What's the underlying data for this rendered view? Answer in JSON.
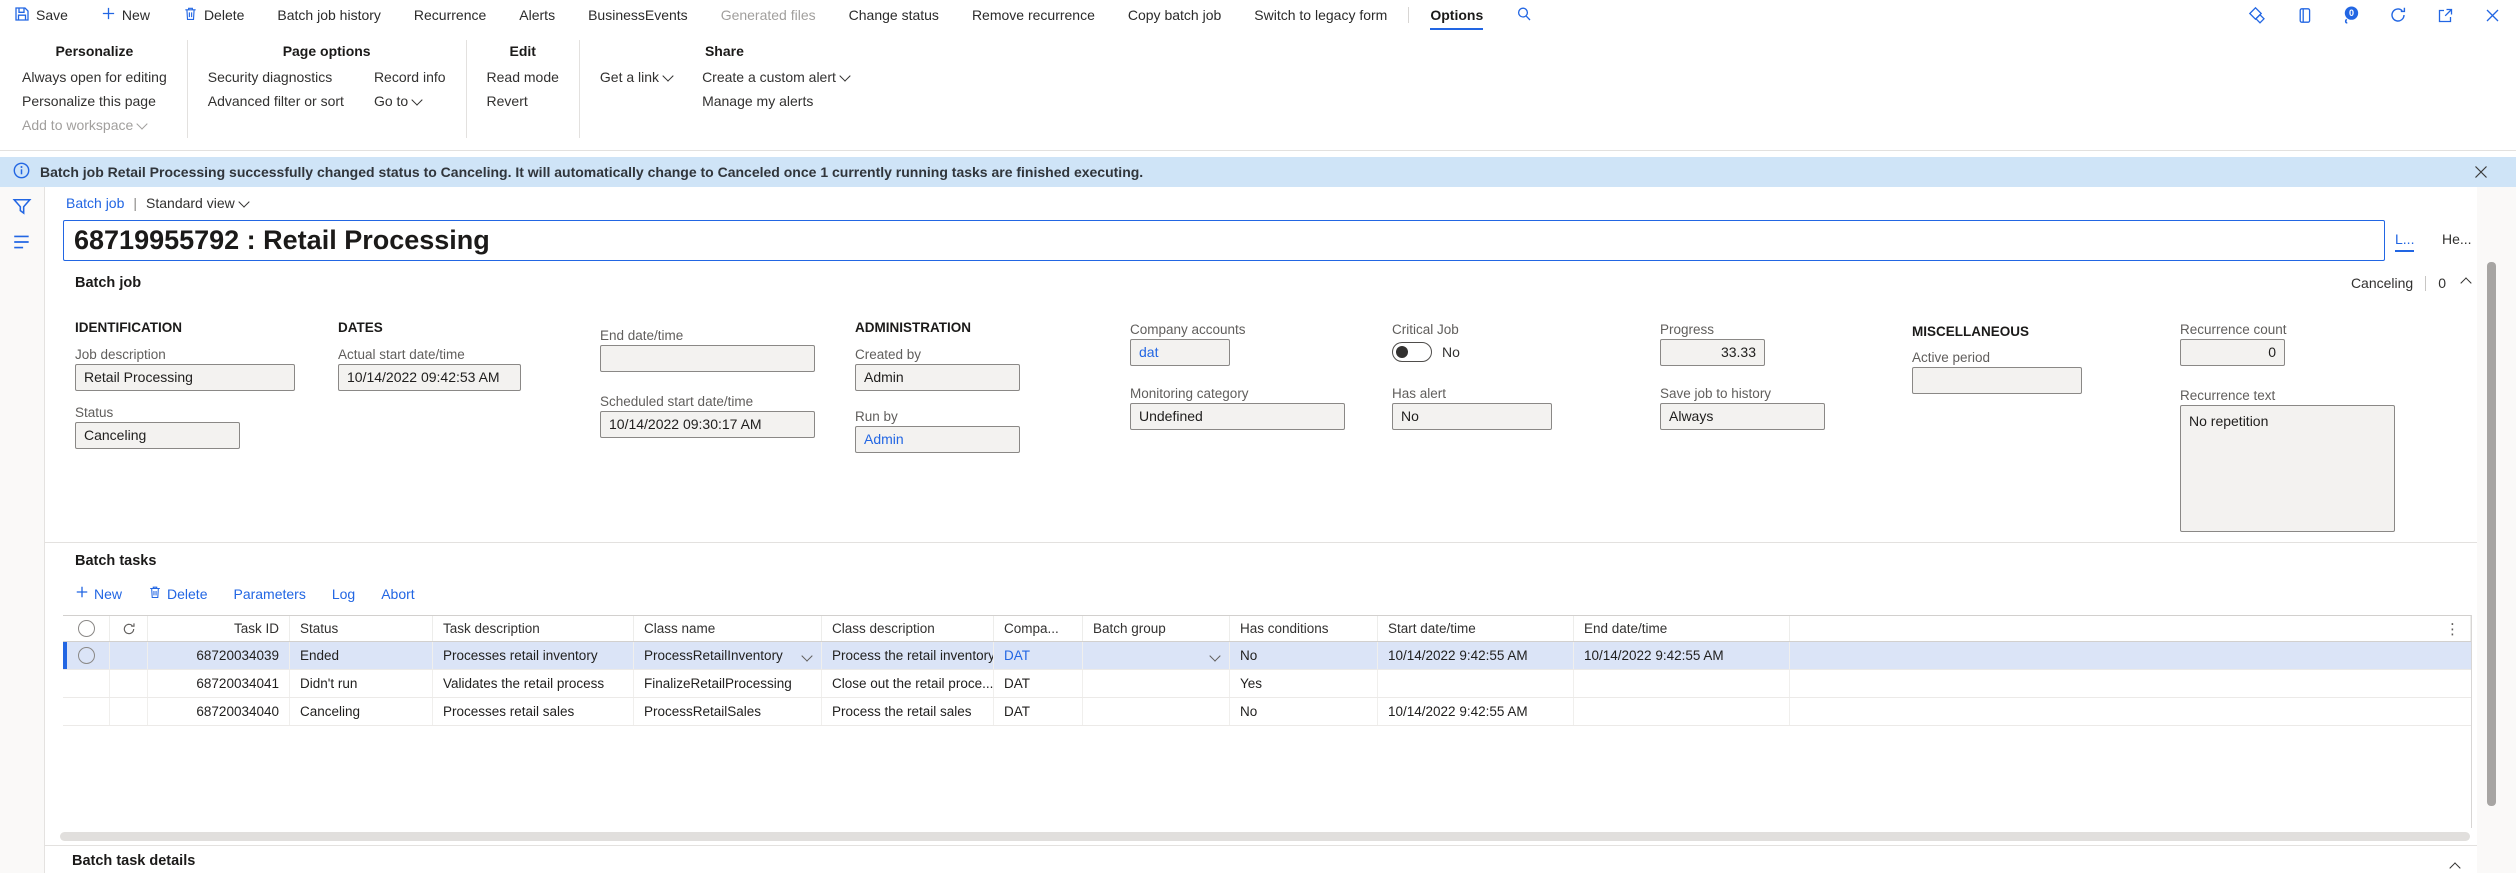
{
  "colors": {
    "accent": "#2266E3",
    "message_bar_bg": "#cfe4f7",
    "selected_row_bg": "#dbe4f7",
    "field_bg": "#f3f2f0",
    "disabled_text": "#a19f9d"
  },
  "icons": [
    "save-icon",
    "plus-icon",
    "trash-icon",
    "search-icon",
    "task-recorder-icon",
    "office-apps-icon",
    "notifications-icon",
    "refresh-icon",
    "popout-icon",
    "close-icon",
    "info-icon",
    "filter-funnel-icon",
    "nav-menu-icon",
    "chevron-down-icon",
    "chevron-up-icon",
    "more-icon",
    "radio-icon"
  ],
  "command_bar": {
    "items": [
      {
        "label": "Save"
      },
      {
        "label": "New"
      },
      {
        "label": "Delete"
      },
      {
        "label": "Batch job history"
      },
      {
        "label": "Recurrence"
      },
      {
        "label": "Alerts"
      },
      {
        "label": "BusinessEvents"
      },
      {
        "label": "Generated files"
      },
      {
        "label": "Change status"
      },
      {
        "label": "Remove recurrence"
      },
      {
        "label": "Copy batch job"
      },
      {
        "label": "Switch to legacy form"
      },
      {
        "label": "Options"
      }
    ],
    "notification_count": "0"
  },
  "ribbon": {
    "personalize": {
      "title": "Personalize",
      "items": [
        "Always open for editing",
        "Personalize this page",
        "Add to workspace"
      ]
    },
    "page_options": {
      "title": "Page options",
      "col1": [
        "Security diagnostics",
        "Advanced filter or sort"
      ],
      "col2": [
        "Record info",
        "Go to"
      ]
    },
    "edit": {
      "title": "Edit",
      "items": [
        "Read mode",
        "Revert"
      ]
    },
    "share": {
      "title": "Share",
      "col1": [
        "Get a link"
      ],
      "col2": [
        "Create a custom alert",
        "Manage my alerts"
      ]
    }
  },
  "message_bar": {
    "text": "Batch job Retail Processing successfully changed status to Canceling. It will automatically change to Canceled once 1 currently running tasks are finished executing."
  },
  "page": {
    "breadcrumb": "Batch job",
    "breadcrumb_separator": "|",
    "view": "Standard view",
    "title": "68719955792 : Retail Processing",
    "tabs": {
      "lines": "L...",
      "header": "He..."
    }
  },
  "sections": {
    "batch_job": {
      "title": "Batch job",
      "status": "Canceling",
      "count": "0"
    },
    "batch_tasks": {
      "title": "Batch tasks"
    },
    "batch_task_details": {
      "title": "Batch task details"
    }
  },
  "form": {
    "identification": {
      "header": "IDENTIFICATION",
      "job_description": {
        "label": "Job description",
        "value": "Retail Processing"
      },
      "status": {
        "label": "Status",
        "value": "Canceling"
      }
    },
    "dates": {
      "header": "DATES",
      "actual_start": {
        "label": "Actual start date/time",
        "value": "10/14/2022 09:42:53 AM"
      },
      "end": {
        "label": "End date/time",
        "value": ""
      },
      "scheduled_start": {
        "label": "Scheduled start date/time",
        "value": "10/14/2022 09:30:17 AM"
      }
    },
    "administration": {
      "header": "ADMINISTRATION",
      "created_by": {
        "label": "Created by",
        "value": "Admin"
      },
      "run_by": {
        "label": "Run by",
        "value": "Admin"
      },
      "company_accounts": {
        "label": "Company accounts",
        "value": "dat"
      },
      "monitoring_category": {
        "label": "Monitoring category",
        "value": "Undefined"
      },
      "critical_job": {
        "label": "Critical Job",
        "value": "No"
      },
      "has_alert": {
        "label": "Has alert",
        "value": "No"
      },
      "progress": {
        "label": "Progress",
        "value": "33.33"
      },
      "save_job_to_history": {
        "label": "Save job to history",
        "value": "Always"
      }
    },
    "miscellaneous": {
      "header": "MISCELLANEOUS",
      "active_period": {
        "label": "Active period",
        "value": ""
      },
      "recurrence_count": {
        "label": "Recurrence count",
        "value": "0"
      },
      "recurrence_text": {
        "label": "Recurrence text",
        "value": "No repetition"
      }
    }
  },
  "batch_tasks": {
    "toolbar": [
      "New",
      "Delete",
      "Parameters",
      "Log",
      "Abort"
    ],
    "columns": [
      "Task ID",
      "Status",
      "Task description",
      "Class name",
      "Class description",
      "Compa...",
      "Batch group",
      "Has conditions",
      "Start date/time",
      "End date/time"
    ],
    "rows": [
      [
        "68720034039",
        "Ended",
        "Processes retail inventory",
        "ProcessRetailInventory",
        "Process the retail inventory",
        "DAT",
        "",
        "No",
        "10/14/2022 9:42:55 AM",
        "10/14/2022 9:42:55 AM"
      ],
      [
        "68720034041",
        "Didn't run",
        "Validates the retail process",
        "FinalizeRetailProcessing",
        "Close out the retail proce...",
        "DAT",
        "",
        "Yes",
        "",
        ""
      ],
      [
        "68720034040",
        "Canceling",
        "Processes retail sales",
        "ProcessRetailSales",
        "Process the retail sales",
        "DAT",
        "",
        "No",
        "10/14/2022 9:42:55 AM",
        ""
      ]
    ]
  }
}
